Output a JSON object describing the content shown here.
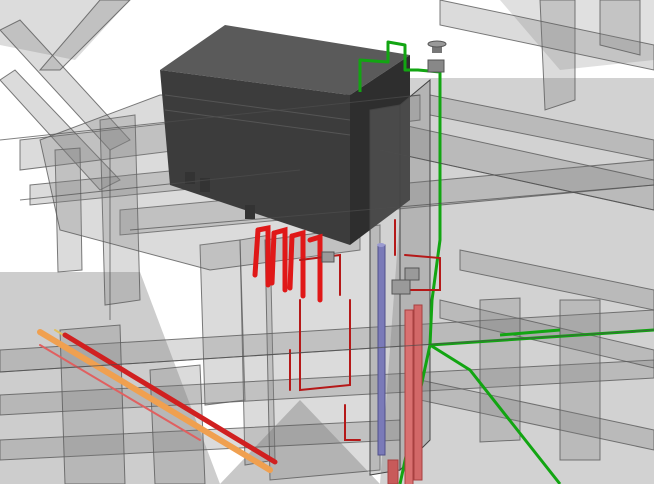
{
  "scene": {
    "colors": {
      "background": "#ffffff",
      "floor": "#cfcfcf",
      "glass_structure": "#8a8a8a",
      "equipment_box": "#4a4a4a",
      "red_pipe": "#e01818",
      "dark_red_pipe": "#b02020",
      "pink_pipe": "#d97070",
      "green_pipe": "#12a512",
      "blue_pipe": "#7a7ab8",
      "orange_pipe": "#f0a050"
    },
    "objects": [
      "transparent-concrete-frame",
      "rooftop-equipment-unit",
      "red-piping-coils",
      "green-pipe",
      "blue-vertical-pipe",
      "floor-pipes"
    ]
  }
}
